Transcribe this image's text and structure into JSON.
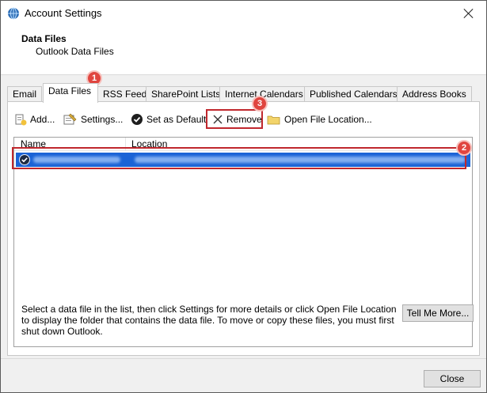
{
  "window": {
    "title": "Account Settings",
    "close": "Close window"
  },
  "header": {
    "title": "Data Files",
    "subtitle": "Outlook Data Files"
  },
  "tabs": [
    {
      "label": "Email"
    },
    {
      "label": "Data Files",
      "active": true
    },
    {
      "label": "RSS Feeds"
    },
    {
      "label": "SharePoint Lists"
    },
    {
      "label": "Internet Calendars"
    },
    {
      "label": "Published Calendars"
    },
    {
      "label": "Address Books"
    }
  ],
  "toolbar": {
    "add_label": "Add...",
    "settings_label": "Settings...",
    "default_label": "Set as Default",
    "remove_label": "Remove",
    "open_location_label": "Open File Location..."
  },
  "list": {
    "columns": [
      "Name",
      "Location"
    ],
    "rows": [
      {
        "selected": true,
        "default": true
      }
    ]
  },
  "description": "Select a data file in the list, then click Settings for more details or click Open File Location to display the folder that contains the data file. To move or copy these files, you must first shut down Outlook.",
  "buttons": {
    "tell_me_more": "Tell Me More...",
    "close": "Close"
  },
  "callouts": [
    "1",
    "2",
    "3"
  ],
  "colors": {
    "accent_red": "#c0272d",
    "callout_fill": "#e0453f",
    "selection": "#1b63d6"
  }
}
